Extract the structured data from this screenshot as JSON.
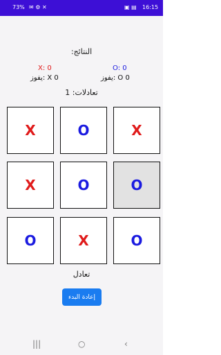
{
  "status": {
    "battery": "73%",
    "time": "16:15",
    "left_icons": "✉ ⚙ ✕",
    "right_icons": "▣ ▤"
  },
  "scores": {
    "title": "النتائج:",
    "x_label": "X: 0",
    "o_label": "O: 0",
    "x_wins": "يفوز: X 0",
    "o_wins": "يفوز: O 0",
    "ties": "تعادلات: 1"
  },
  "board": {
    "cells": [
      "X",
      "O",
      "X",
      "X",
      "O",
      "O",
      "O",
      "X",
      "O"
    ]
  },
  "result": "تعادل",
  "restart_label": "إعادة البدء",
  "nav": {
    "recent": "|||",
    "home": "○",
    "back": "‹"
  }
}
